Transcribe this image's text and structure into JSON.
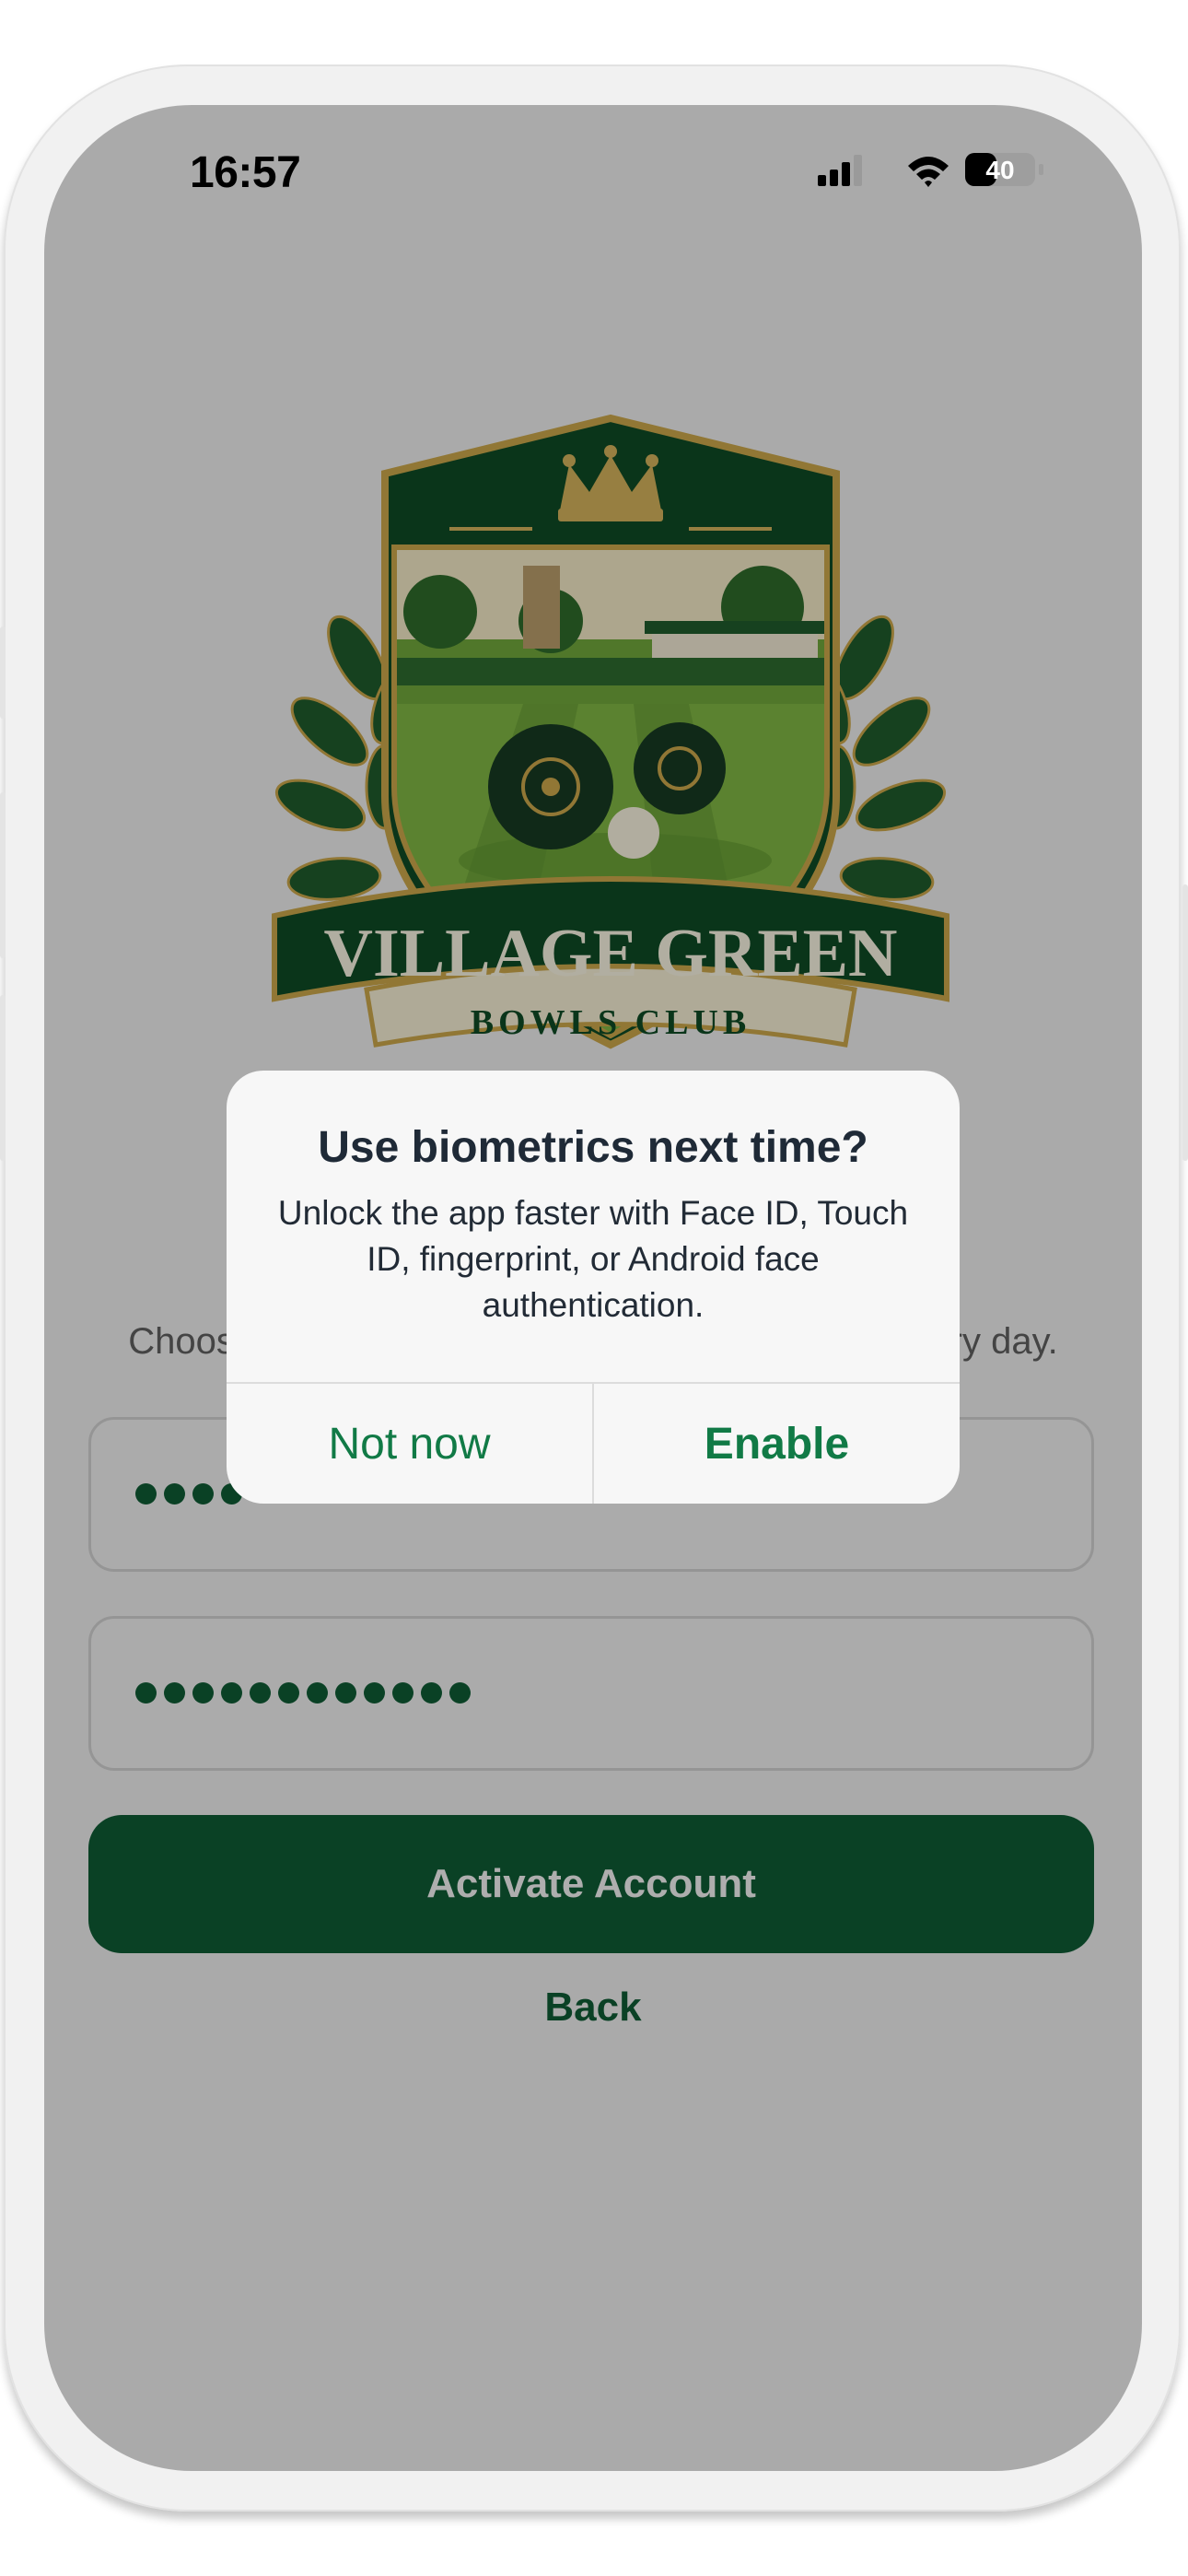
{
  "status_bar": {
    "time": "16:57",
    "battery_level": "40"
  },
  "logo": {
    "title": "VILLAGE GREEN",
    "subtitle": "BOWLS CLUB"
  },
  "form": {
    "subtitle_left": "Choose",
    "subtitle_right": "ery day.",
    "field_1": {
      "masked_visible_count": 4
    },
    "field_2": {
      "masked_visible_count": 12
    },
    "activate_label": "Activate Account",
    "back_label": "Back"
  },
  "alert": {
    "title": "Use biometrics next time?",
    "message": "Unlock the app faster with Face ID, Touch ID, fingerprint, or Android face authentication.",
    "cancel_label": "Not now",
    "confirm_label": "Enable"
  },
  "colors": {
    "brand_green": "#0e5a34",
    "action_green": "#117a46",
    "gold": "#c9a64a",
    "cream": "#f3ecd2"
  }
}
